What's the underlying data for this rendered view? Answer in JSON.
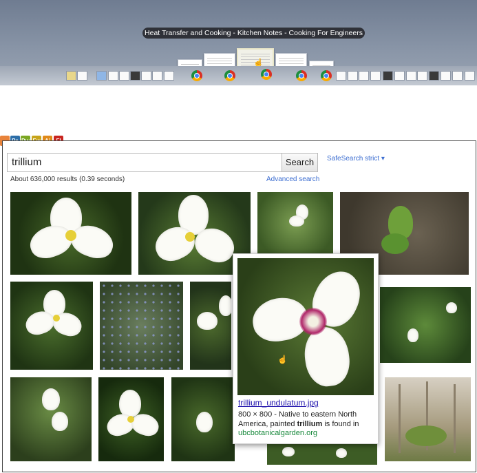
{
  "dock": {
    "title": "Heat Transfer and Cooking - Kitchen Notes - Cooking For Engineers",
    "app_icons": [
      {
        "label": "",
        "name": "finder-icon",
        "color": "#2a7de1"
      },
      {
        "label": "Ps",
        "name": "photoshop-icon",
        "color": "#2c6ea8"
      },
      {
        "label": "Dw",
        "name": "dreamweaver-icon",
        "color": "#7ba722"
      },
      {
        "label": "Fw",
        "name": "fireworks-icon",
        "color": "#c7a41a"
      },
      {
        "label": "Ai",
        "name": "illustrator-icon",
        "color": "#e08a1a"
      },
      {
        "label": "Fl",
        "name": "flash-icon",
        "color": "#c8251f"
      }
    ]
  },
  "search": {
    "query": "trillium",
    "button_label": "Search",
    "safesearch": "SafeSearch strict ▾",
    "results_stats": "About 636,000 results (0.39 seconds)",
    "advanced_label": "Advanced search"
  },
  "popup": {
    "filename": "trillium_undulatum.jpg",
    "desc_prefix": "800 × 800 - Native to eastern North America, painted ",
    "desc_bold": "trillium",
    "desc_suffix": " is found in",
    "source": "ubcbotanicalgarden.org"
  },
  "colors": {
    "link": "#1a0dab",
    "accent": "#3d6ed1",
    "source_green": "#16883a"
  }
}
